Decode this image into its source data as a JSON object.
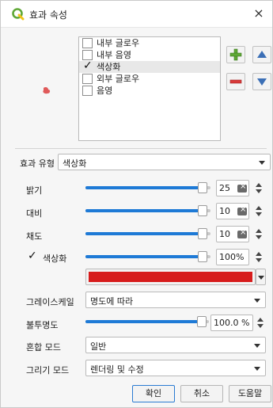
{
  "window": {
    "title": "효과 속성",
    "close_glyph": "×",
    "icon": "qgis-logo-icon"
  },
  "effects_list": {
    "items": [
      {
        "label": "내부 글로우",
        "checked": false
      },
      {
        "label": "내부 음영",
        "checked": false
      },
      {
        "label": "색상화",
        "checked": true
      },
      {
        "label": "외부 글로우",
        "checked": false
      },
      {
        "label": "음영",
        "checked": false
      }
    ],
    "selected_index": 2
  },
  "list_buttons": {
    "add": "plus-icon",
    "remove": "minus-icon",
    "up": "arrow-up-icon",
    "down": "arrow-down-icon"
  },
  "effect_type": {
    "label": "효과 유형",
    "value": "색상화"
  },
  "brightness": {
    "label": "밝기",
    "value_text": "25",
    "fraction": 0.97
  },
  "contrast": {
    "label": "대비",
    "value_text": "10",
    "fraction": 0.97
  },
  "saturation": {
    "label": "채도",
    "value_text": "10",
    "fraction": 0.97
  },
  "colorize": {
    "label": "색상화",
    "checked": true,
    "value_text": "100%",
    "fraction": 0.97
  },
  "color": {
    "swatch_hex": "#d71c1c"
  },
  "grayscale": {
    "label": "그레이스케일",
    "value": "명도에 따라"
  },
  "opacity": {
    "label": "불투명도",
    "value_text": "100.0 %",
    "fraction": 0.98
  },
  "blend_mode": {
    "label": "혼합 모드",
    "value": "일반"
  },
  "draw_mode": {
    "label": "그리기 모드",
    "value": "렌더링 및 수정"
  },
  "footer": {
    "ok": "확인",
    "cancel": "취소",
    "help": "도움말"
  },
  "colors": {
    "accent": "#1e7ad6",
    "qgis_green": "#5fa836",
    "qgis_yellow": "#f0c419",
    "remove_red": "#d93a3a"
  }
}
